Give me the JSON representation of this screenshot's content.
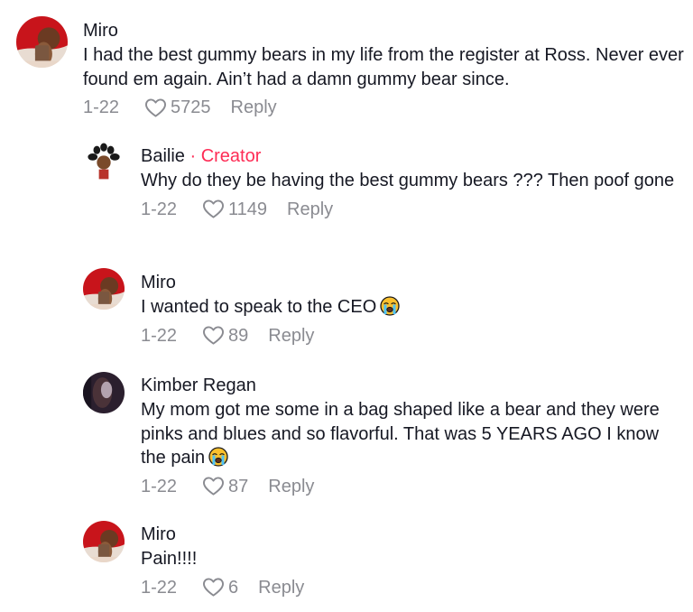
{
  "comments": [
    {
      "author": "Miro",
      "text": "I had the best gummy bears in my life from the register at Ross. Never ever found em again. Ain’t had a damn gummy bear since.",
      "date": "1-22",
      "likes": "5725",
      "reply_label": "Reply"
    },
    {
      "author": "Bailie",
      "creator_badge": " · Creator",
      "text": "Why do they be having the best gummy bears ??? Then poof gone",
      "date": "1-22",
      "likes": "1149",
      "reply_label": "Reply"
    },
    {
      "author": "Miro",
      "text": "I wanted to speak to the CEO",
      "emoji": "loudly-crying-face",
      "date": "1-22",
      "likes": "89",
      "reply_label": "Reply"
    },
    {
      "author": "Kimber Regan",
      "text": "My mom got me some in a bag shaped like a bear and they were pinks and blues and so flavorful. That was 5 YEARS AGO I know the pain",
      "emoji": "loudly-crying-face",
      "date": "1-22",
      "likes": "87",
      "reply_label": "Reply"
    },
    {
      "author": "Miro",
      "text": "Pain!!!!",
      "date": "1-22",
      "likes": "6",
      "reply_label": "Reply"
    }
  ],
  "colors": {
    "creator_badge": "#fe2c55",
    "muted_text": "#8a8b91",
    "primary_text": "#161823"
  }
}
